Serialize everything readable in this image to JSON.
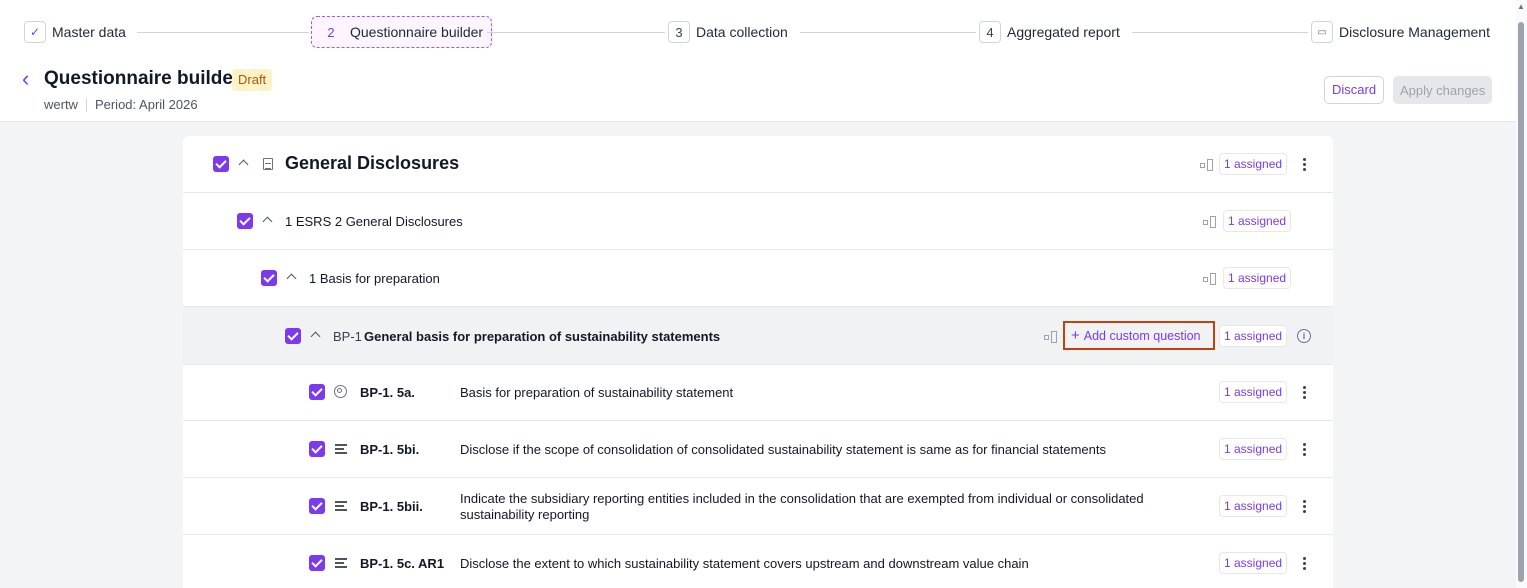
{
  "stepper": {
    "steps": [
      {
        "num": "",
        "label": "Master data"
      },
      {
        "num": "2",
        "label": "Questionnaire builder"
      },
      {
        "num": "3",
        "label": "Data collection"
      },
      {
        "num": "4",
        "label": "Aggregated report"
      },
      {
        "num": "",
        "label": "Disclosure Management"
      }
    ]
  },
  "header": {
    "title": "Questionnaire builder",
    "status": "Draft",
    "project": "wertw",
    "period": "Period: April 2026",
    "discard": "Discard",
    "apply": "Apply changes"
  },
  "tree": {
    "assigned_label": "1 assigned",
    "section": "General Disclosures",
    "standard": "1 ESRS 2 General Disclosures",
    "subsection": "1 Basis for preparation",
    "dr_code": "BP-1",
    "dr_title": "General basis for preparation of sustainability statements",
    "add_custom": "Add custom question",
    "questions": [
      {
        "code": "BP-1. 5a.",
        "text": "Basis for preparation of sustainability statement",
        "icon": "target-icon"
      },
      {
        "code": "BP-1. 5bi.",
        "text": "Disclose if the scope of consolidation of consolidated sustainability statement is same as for financial statements",
        "icon": "text-lines-icon"
      },
      {
        "code": "BP-1. 5bii.",
        "text": "Indicate the subsidiary reporting entities included in the consolidation that are exempted from individual or consolidated",
        "text2": "sustainability reporting",
        "icon": "text-lines-icon"
      },
      {
        "code": "BP-1. 5c. AR1",
        "text": "Disclose the extent to which sustainability statement covers upstream and downstream value chain",
        "icon": "text-lines-icon"
      }
    ]
  }
}
